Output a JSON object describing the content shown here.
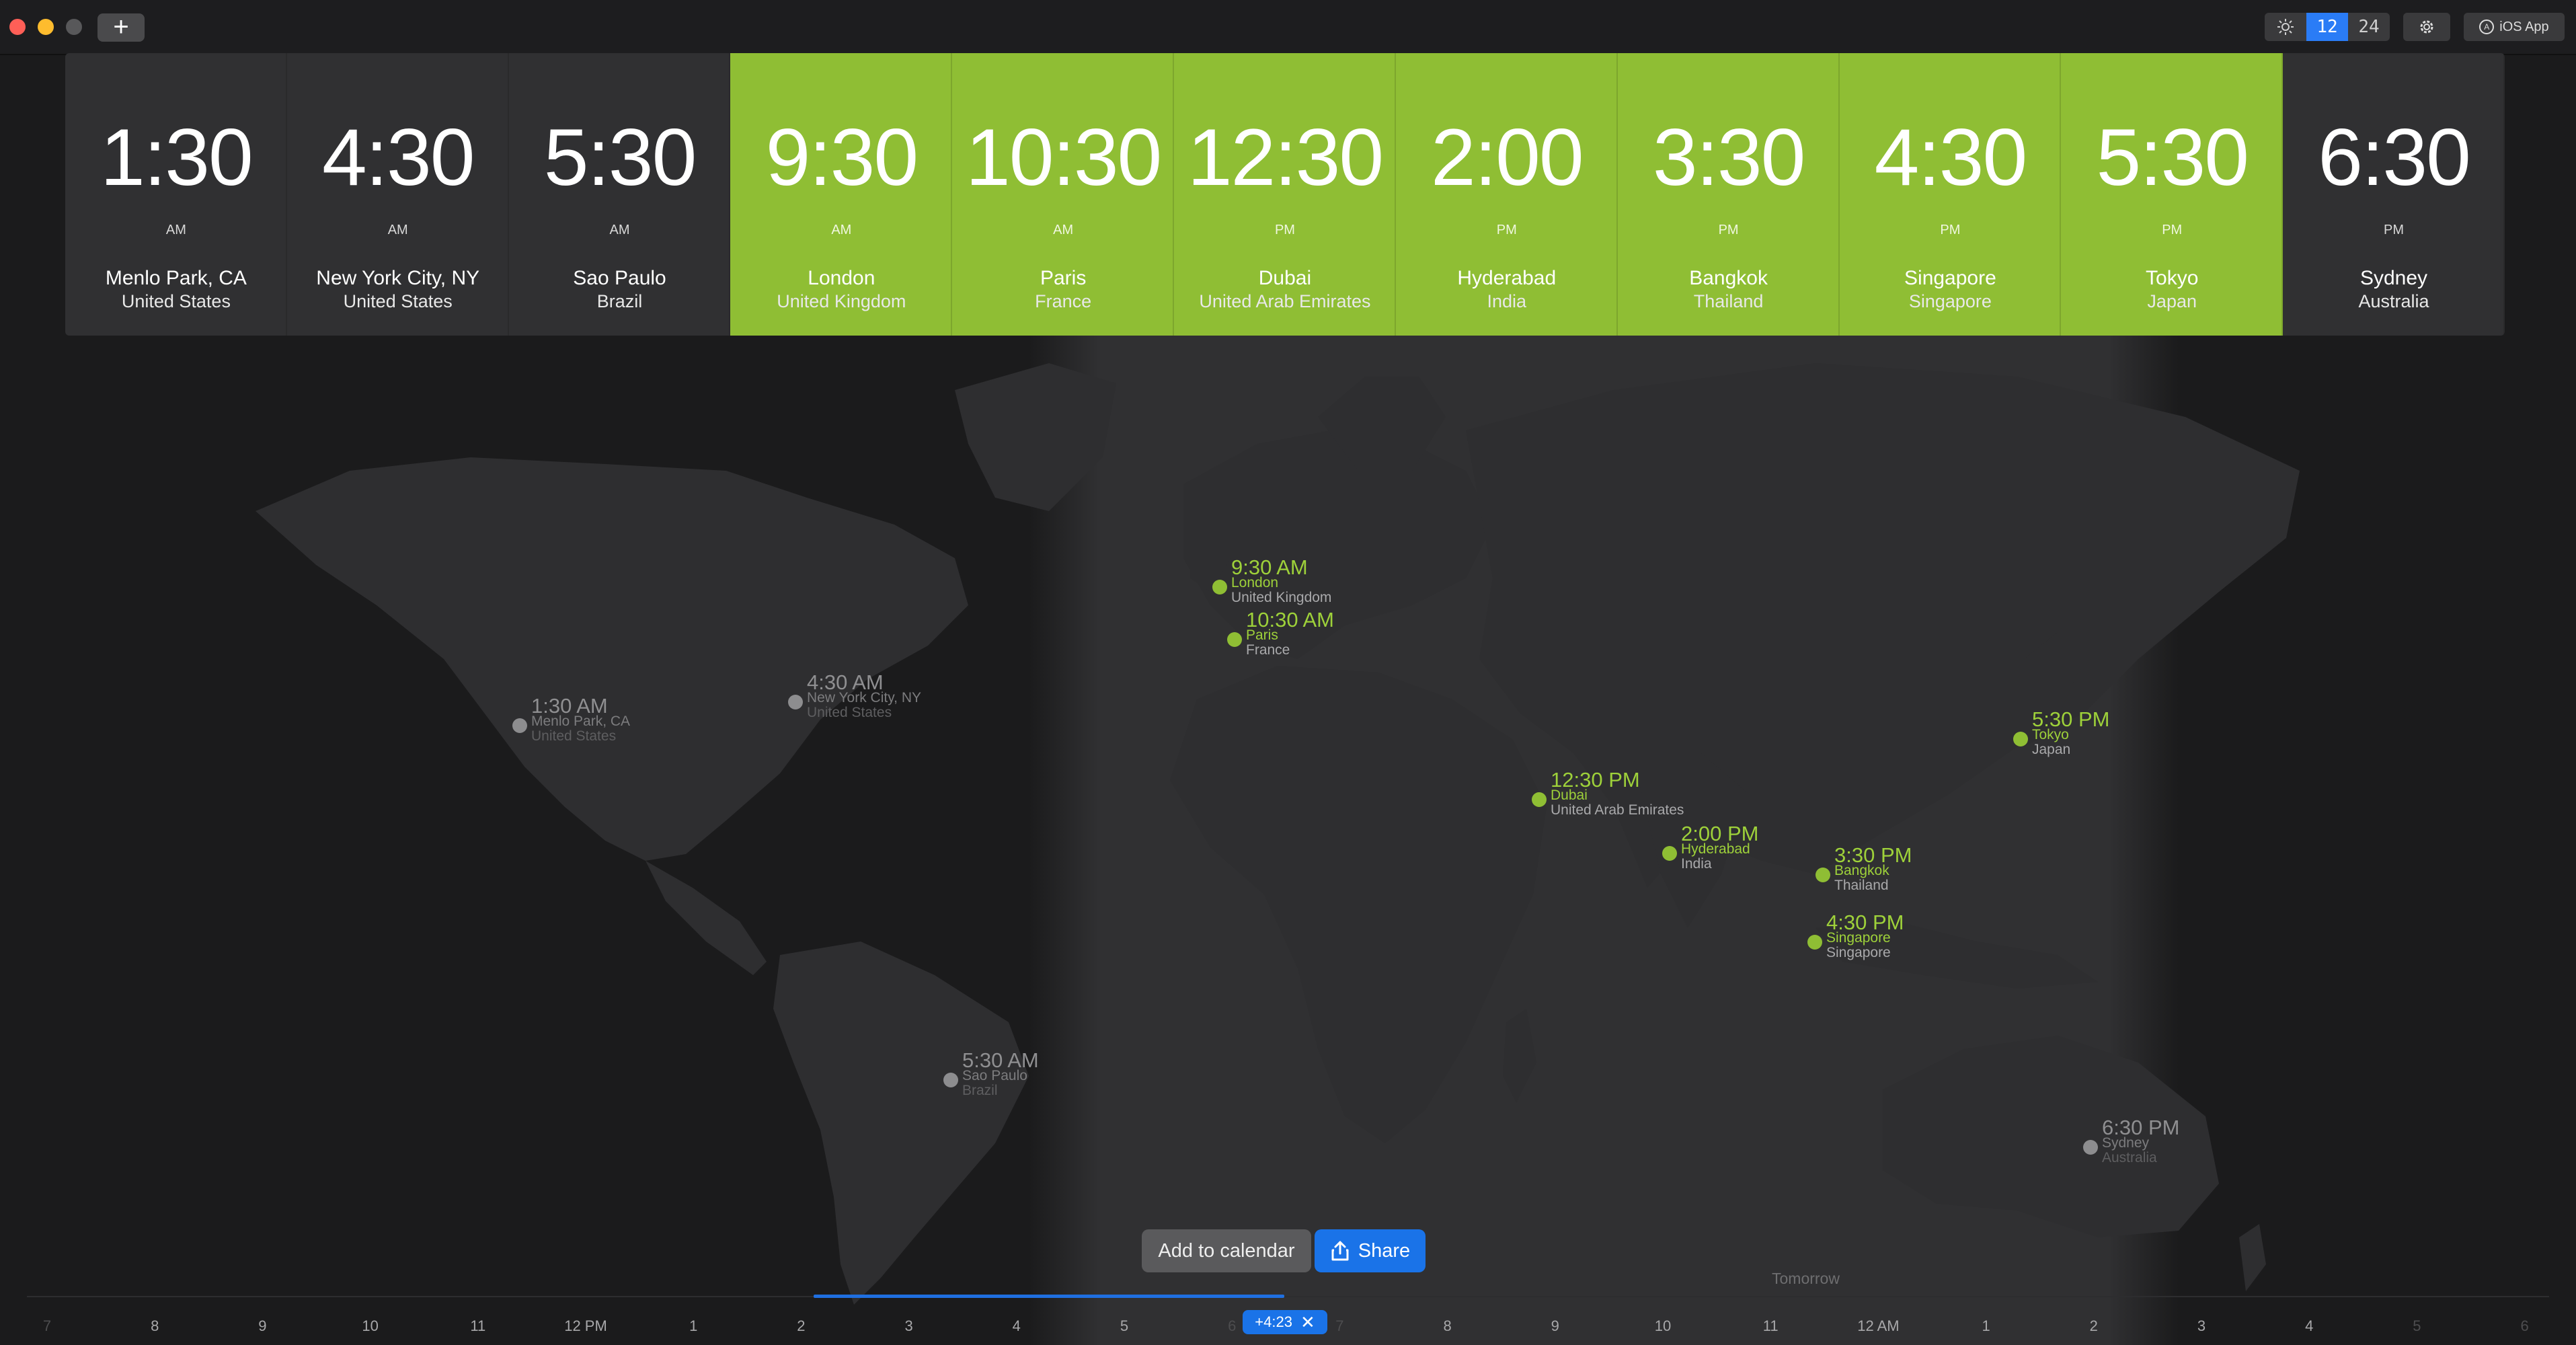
{
  "toolbar": {
    "add_label": "+",
    "format_12": "12",
    "format_24": "24",
    "ios_label": "iOS App"
  },
  "cities": [
    {
      "time": "1:30",
      "ampm": "AM",
      "city": "Menlo Park, CA",
      "country": "United States",
      "day": false
    },
    {
      "time": "4:30",
      "ampm": "AM",
      "city": "New York City, NY",
      "country": "United States",
      "day": false
    },
    {
      "time": "5:30",
      "ampm": "AM",
      "city": "Sao Paulo",
      "country": "Brazil",
      "day": false
    },
    {
      "time": "9:30",
      "ampm": "AM",
      "city": "London",
      "country": "United Kingdom",
      "day": true
    },
    {
      "time": "10:30",
      "ampm": "AM",
      "city": "Paris",
      "country": "France",
      "day": true
    },
    {
      "time": "12:30",
      "ampm": "PM",
      "city": "Dubai",
      "country": "United Arab Emirates",
      "day": true
    },
    {
      "time": "2:00",
      "ampm": "PM",
      "city": "Hyderabad",
      "country": "India",
      "day": true
    },
    {
      "time": "3:30",
      "ampm": "PM",
      "city": "Bangkok",
      "country": "Thailand",
      "day": true
    },
    {
      "time": "4:30",
      "ampm": "PM",
      "city": "Singapore",
      "country": "Singapore",
      "day": true
    },
    {
      "time": "5:30",
      "ampm": "PM",
      "city": "Tokyo",
      "country": "Japan",
      "day": true
    },
    {
      "time": "6:30",
      "ampm": "PM",
      "city": "Sydney",
      "country": "Australia",
      "day": false
    }
  ],
  "map_pins": [
    {
      "time": "1:30 AM",
      "city": "Menlo Park, CA",
      "country": "United States",
      "day": false
    },
    {
      "time": "4:30 AM",
      "city": "New York City, NY",
      "country": "United States",
      "day": false
    },
    {
      "time": "5:30 AM",
      "city": "Sao Paulo",
      "country": "Brazil",
      "day": false
    },
    {
      "time": "9:30 AM",
      "city": "London",
      "country": "United Kingdom",
      "day": true
    },
    {
      "time": "10:30 AM",
      "city": "Paris",
      "country": "France",
      "day": true
    },
    {
      "time": "12:30 PM",
      "city": "Dubai",
      "country": "United Arab Emirates",
      "day": true
    },
    {
      "time": "2:00 PM",
      "city": "Hyderabad",
      "country": "India",
      "day": true
    },
    {
      "time": "3:30 PM",
      "city": "Bangkok",
      "country": "Thailand",
      "day": true
    },
    {
      "time": "4:30 PM",
      "city": "Singapore",
      "country": "Singapore",
      "day": true
    },
    {
      "time": "5:30 PM",
      "city": "Tokyo",
      "country": "Japan",
      "day": true
    },
    {
      "time": "6:30 PM",
      "city": "Sydney",
      "country": "Australia",
      "day": false
    }
  ],
  "actions": {
    "add_to_calendar": "Add to calendar",
    "share": "Share"
  },
  "timeline": {
    "tomorrow_label": "Tomorrow",
    "offset": "+4:23",
    "ticks": [
      "7",
      "8",
      "9",
      "10",
      "11",
      "12 PM",
      "1",
      "2",
      "3",
      "4",
      "5",
      "6",
      "7",
      "8",
      "9",
      "10",
      "11",
      "12 AM",
      "1",
      "2",
      "3",
      "4",
      "5",
      "6"
    ]
  },
  "colors": {
    "day_accent": "#8fbe34",
    "night_tile": "#303032",
    "selection_blue": "#1a73e8",
    "background": "#1b1b1c"
  },
  "icons": {
    "brightness": "sun-icon",
    "settings": "gear-icon",
    "ios": "app-store-icon",
    "share": "share-icon",
    "clear_offset": "close-icon"
  }
}
